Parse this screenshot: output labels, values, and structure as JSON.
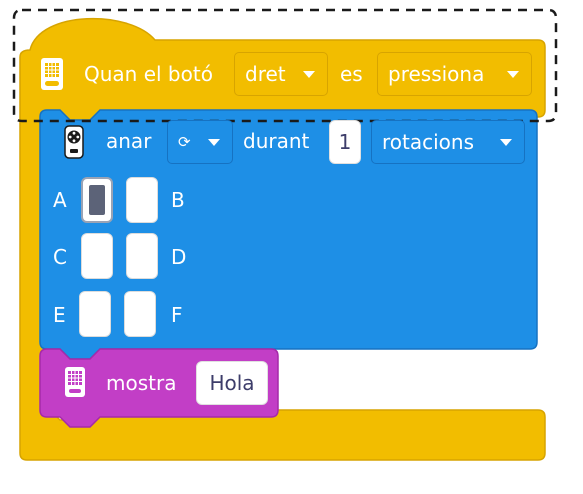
{
  "hat_block": {
    "label_prefix": "Quan el botó",
    "button_value": "dret",
    "connector": "es",
    "action_value": "pressiona",
    "hub_icon": "hub-icon",
    "color": "#f2bd00"
  },
  "motor_block": {
    "verb": "anar",
    "direction_icon": "rotate-icon",
    "direction_glyph": "⟳",
    "preposition": "durant",
    "amount": "1",
    "unit": "rotacions",
    "motor_icon": "motor-icon",
    "color": "#1e8fe6",
    "ports": [
      {
        "label": "A",
        "selected": true
      },
      {
        "label": "B",
        "selected": false
      },
      {
        "label": "C",
        "selected": false
      },
      {
        "label": "D",
        "selected": false
      },
      {
        "label": "E",
        "selected": false
      },
      {
        "label": "F",
        "selected": false
      }
    ]
  },
  "display_block": {
    "verb": "mostra",
    "text": "Hola",
    "display_icon": "light-matrix-icon",
    "color": "#c23ec6"
  }
}
